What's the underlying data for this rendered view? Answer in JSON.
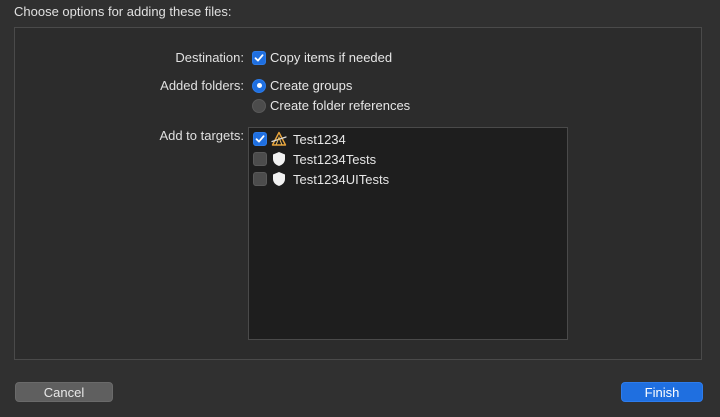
{
  "header": {
    "prompt": "Choose options for adding these files:"
  },
  "options": {
    "destination_label": "Destination:",
    "copy_items_label": "Copy items if needed",
    "copy_items_checked": true,
    "added_folders_label": "Added folders:",
    "create_groups_label": "Create groups",
    "create_folder_refs_label": "Create folder references",
    "selected_folder_option": "Create groups",
    "add_to_targets_label": "Add to targets:"
  },
  "targets": [
    {
      "name": "Test1234",
      "checked": true,
      "icon": "app-icon"
    },
    {
      "name": "Test1234Tests",
      "checked": false,
      "icon": "test-bundle-icon"
    },
    {
      "name": "Test1234UITests",
      "checked": false,
      "icon": "test-bundle-icon"
    }
  ],
  "buttons": {
    "cancel_label": "Cancel",
    "finish_label": "Finish"
  },
  "colors": {
    "accent": "#1f6fe0",
    "background": "#303030",
    "list_background": "#1e1e1e"
  }
}
